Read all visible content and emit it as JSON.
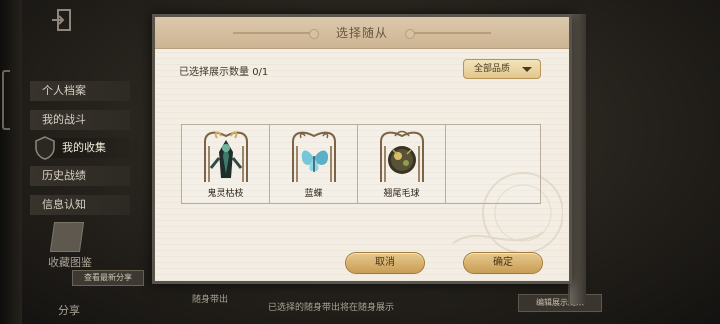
{
  "background": {
    "menu_items": [
      {
        "label": "个人档案",
        "active": false
      },
      {
        "label": "我的战斗",
        "active": false
      },
      {
        "label": "我的收集",
        "active": true
      },
      {
        "label": "历史战绩",
        "active": false
      },
      {
        "label": "信息认知",
        "active": false
      }
    ],
    "card_label": "收藏图鉴",
    "share_label": "查看最新分享",
    "share_caption": "分享",
    "footer_hint_left": "随身带出",
    "footer_hint_center": "已选择的随身带出将在随身展示",
    "footer_button": "编辑展示随从"
  },
  "dialog": {
    "title": "选择随从",
    "count_label": "已选择展示数量",
    "count_value": "0/1",
    "quality_filter": "全部品质",
    "companions": [
      {
        "name": "鬼灵枯枝",
        "icon": "ghost-branch-icon"
      },
      {
        "name": "蓝蝶",
        "icon": "blue-butterfly-icon"
      },
      {
        "name": "翘尾毛球",
        "icon": "fluffy-ball-icon"
      }
    ],
    "cancel_label": "取消",
    "confirm_label": "确定"
  },
  "colors": {
    "accent_gold": "#c99d55",
    "paper": "#f3ede3",
    "title_bar": "#d6c0a0"
  }
}
